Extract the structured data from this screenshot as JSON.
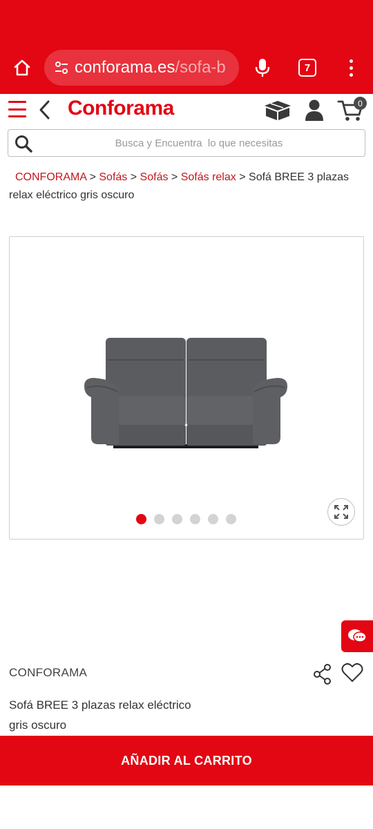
{
  "browser": {
    "url_domain": "conforama.es",
    "url_path": "/sofa-b",
    "tab_count": "7",
    "theme_color": "#e30613"
  },
  "header": {
    "logo_text": "Conforama",
    "cart_count": "0",
    "icons": [
      "hamburger-menu-icon",
      "back-arrow-icon",
      "box-icon",
      "user-icon",
      "cart-icon"
    ]
  },
  "search": {
    "placeholder": "Busca y Encuentra  lo que necesitas"
  },
  "breadcrumb": {
    "items": [
      "CONFORAMA",
      "Sofás",
      "Sofás",
      "Sofás relax"
    ],
    "separator": ">",
    "current": "Sofá BREE 3 plazas relax eléctrico gris oscuro"
  },
  "gallery": {
    "image_alt": "Sofá BREE 3 plazas relax eléctrico gris oscuro",
    "image_count": 6,
    "active_index": 0
  },
  "product": {
    "brand": "CONFORAMA",
    "title_line1": "Sofá BREE 3 plazas relax eléctrico",
    "title_line2": "gris oscuro"
  },
  "cta": {
    "add_to_cart_label": "AÑADIR AL CARRITO"
  }
}
